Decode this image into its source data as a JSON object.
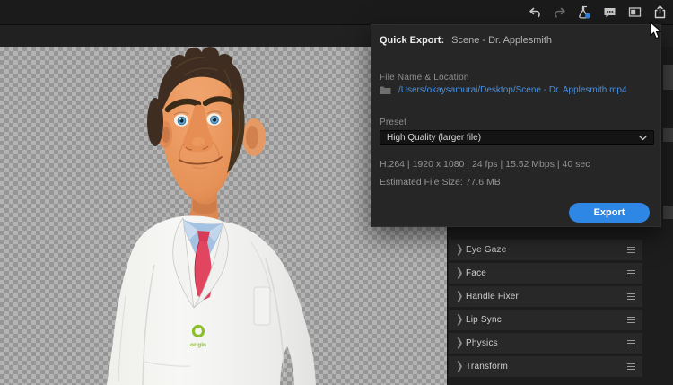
{
  "toolbar": {
    "icons": [
      {
        "name": "undo-icon"
      },
      {
        "name": "redo-icon"
      },
      {
        "name": "beta-flask-icon"
      },
      {
        "name": "feedback-icon"
      },
      {
        "name": "panel-view-icon"
      },
      {
        "name": "share-export-icon"
      }
    ]
  },
  "quick_export": {
    "title": "Quick Export:",
    "scene_name": "Scene - Dr. Applesmith",
    "file_section_label": "File Name & Location",
    "file_path": "/Users/okaysamurai/Desktop/Scene - Dr. Applesmith.mp4",
    "preset_label": "Preset",
    "preset_value": "High Quality (larger file)",
    "specs": "H.264 | 1920 x 1080 | 24 fps | 15.52 Mbps | 40 sec",
    "estimated_size": "Estimated File Size: 77.6 MB",
    "export_button_label": "Export",
    "accent_color": "#2e86e5",
    "link_color": "#4a8fdc"
  },
  "behaviors": {
    "items": [
      "Eye Gaze",
      "Face",
      "Handle Fixer",
      "Lip Sync",
      "Physics",
      "Transform"
    ]
  },
  "scene": {
    "logo_text": "origin"
  }
}
